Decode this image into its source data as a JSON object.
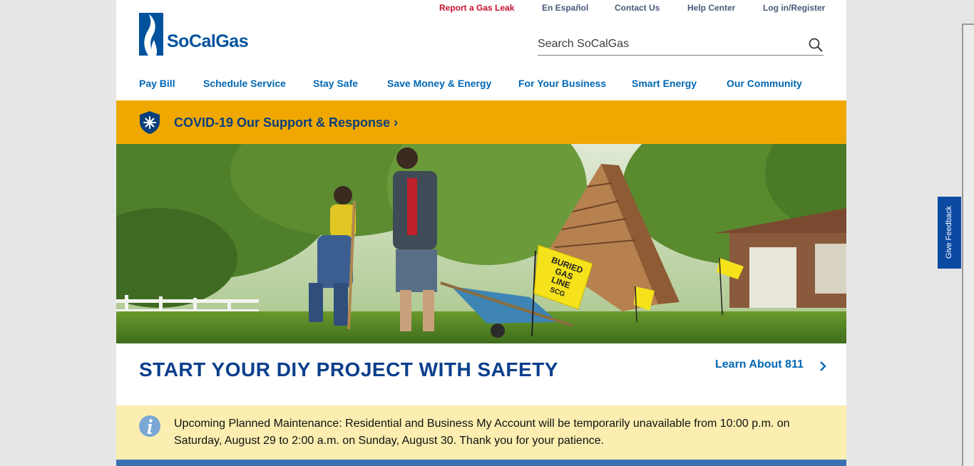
{
  "utility_nav": {
    "report_leak": "Report a Gas Leak",
    "espanol": "En Español",
    "contact": "Contact Us",
    "help": "Help Center",
    "login": "Log in/Register"
  },
  "logo": {
    "text": "SoCalGas"
  },
  "search": {
    "placeholder": "Search SoCalGas",
    "icon": "search-icon"
  },
  "main_nav": [
    {
      "label": "Pay Bill"
    },
    {
      "label": "Schedule Service"
    },
    {
      "label": "Stay Safe"
    },
    {
      "label": "Save Money & Energy"
    },
    {
      "label": "For Your Business"
    },
    {
      "label": "Smart Energy"
    },
    {
      "label": "Our Community"
    }
  ],
  "covid_banner": {
    "label": "COVID-19 Our Support & Response",
    "chevron": "›",
    "color": "#f0a800"
  },
  "hero": {
    "flag_text": [
      "BURIED",
      "GAS",
      "LINE",
      "SCG"
    ],
    "headline": "START YOUR DIY PROJECT WITH SAFETY",
    "cta": "Learn About 811"
  },
  "notice": {
    "text": "Upcoming Planned Maintenance: Residential and Business My Account will be temporarily unavailable from 10:00 p.m. on Saturday, August 29 to 2:00 a.m. on Sunday, August 30. Thank you for your patience.",
    "icon": "info-icon",
    "color": "#fbeeb0"
  },
  "feedback_tab": {
    "label": "Give Feedback"
  },
  "colors": {
    "brand_blue": "#00529c",
    "link_blue": "#0067b4",
    "alert_red": "#c8102e"
  }
}
